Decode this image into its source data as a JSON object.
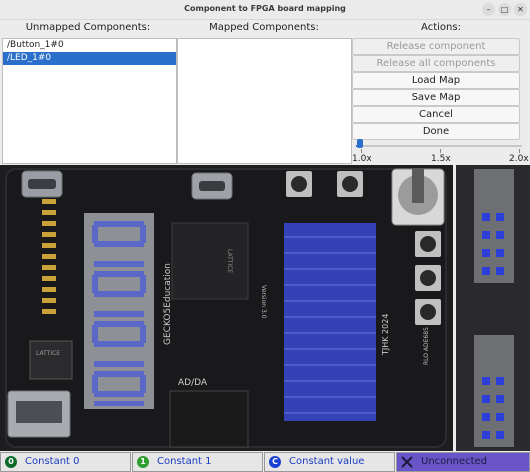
{
  "window": {
    "title": "Component to FPGA board mapping"
  },
  "headers": {
    "unmapped": "Unmapped Components:",
    "mapped": "Mapped Components:",
    "actions": "Actions:"
  },
  "unmapped_items": [
    "/Button_1#0",
    "/LED_1#0"
  ],
  "actions": {
    "release_component": "Release component",
    "release_all": "Release all components",
    "load_map": "Load Map",
    "save_map": "Save Map",
    "cancel": "Cancel",
    "done": "Done"
  },
  "zoom": {
    "min_label": "1.0x",
    "mid_label": "1.5x",
    "max_label": "2.0x",
    "value": 1.0
  },
  "board_text": {
    "education": "GECKO5Education",
    "version": "Version 3.0",
    "lattice": "LATTICE",
    "lattice_chip": "LATTICE",
    "year": "TJHK 2024",
    "ad_da": "AD/DA",
    "rlo": "RLO ADE685"
  },
  "legend": {
    "constant0": {
      "badge": "0",
      "label": "Constant 0",
      "color": "#0a6b2a"
    },
    "constant1": {
      "badge": "1",
      "label": "Constant 1",
      "color": "#2e9e2e"
    },
    "constant_value": {
      "badge": "C",
      "label": "Constant value",
      "color": "#1b3fd6"
    },
    "unconnected": {
      "label": "Unconnected",
      "color": "#6a55c8"
    }
  }
}
